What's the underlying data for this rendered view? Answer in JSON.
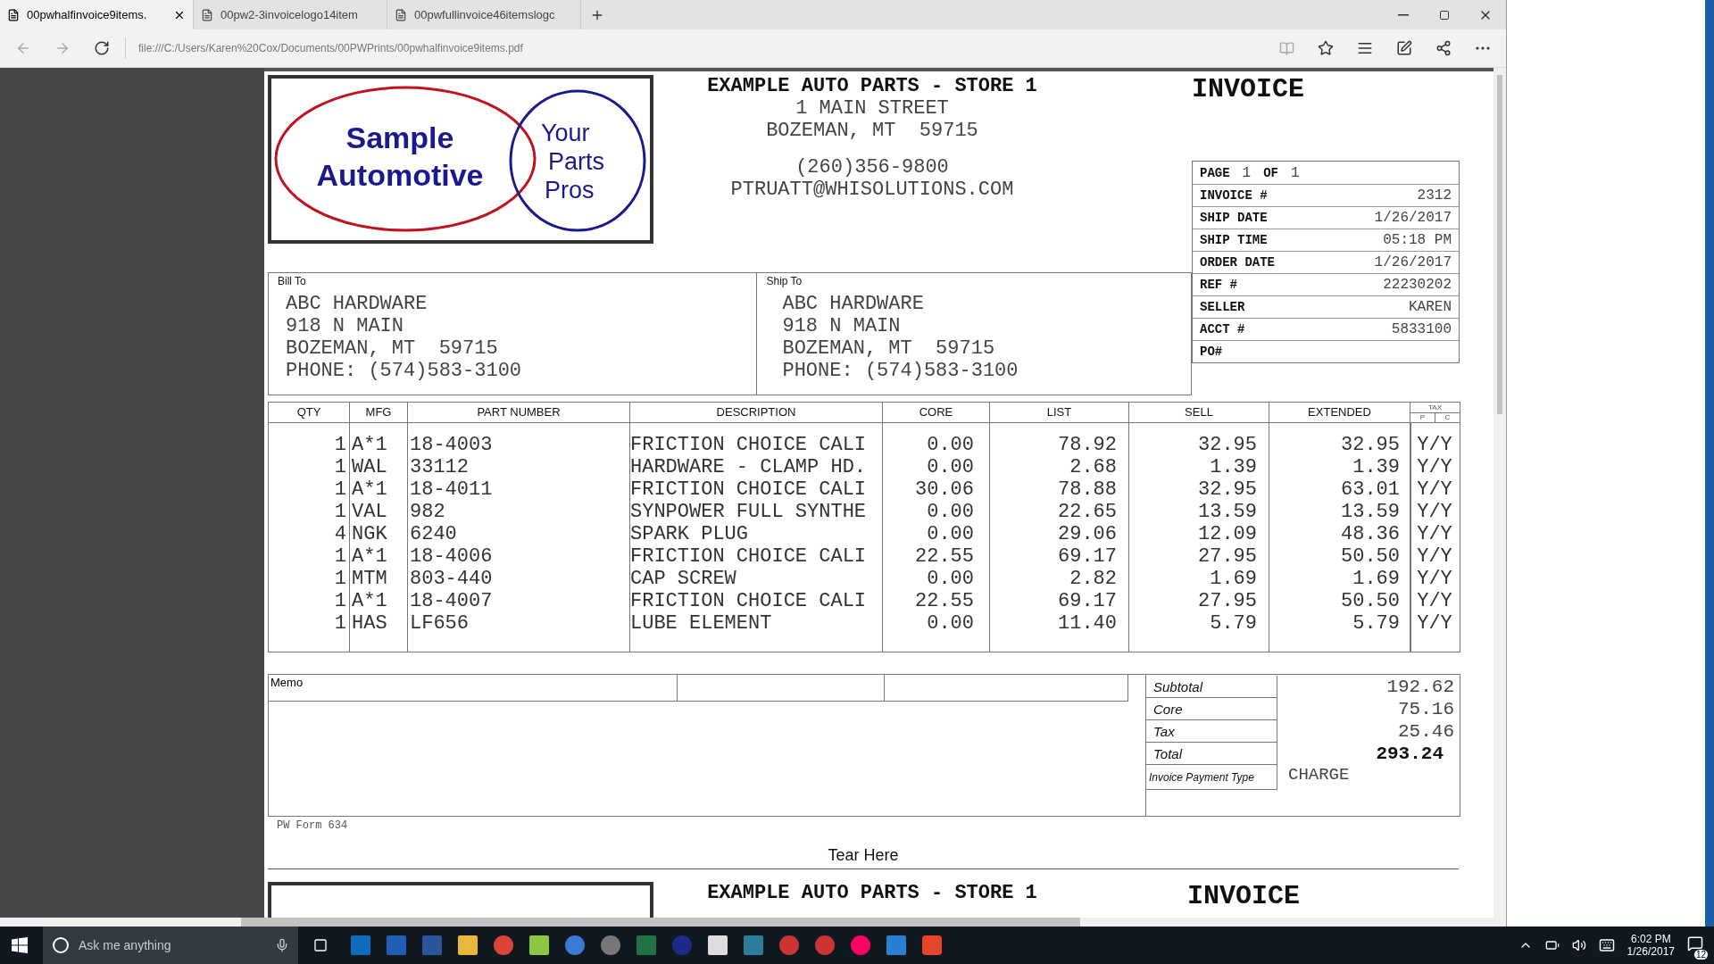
{
  "browser": {
    "tabs": [
      {
        "title": "00pwhalfinvoice9items.",
        "selected": true
      },
      {
        "title": "00pw2-3invoicelogo14item",
        "selected": false
      },
      {
        "title": "00pwfullinvoice46itemslogc",
        "selected": false
      }
    ],
    "address": "file:///C:/Users/Karen%20Cox/Documents/00PWPrints/00pwhalfinvoice9items.pdf"
  },
  "invoice": {
    "logo": {
      "name_lines": [
        "Sample",
        "Automotive"
      ],
      "tagline_lines": [
        "Your",
        "Parts",
        "Pros"
      ]
    },
    "store": {
      "name": "EXAMPLE AUTO PARTS - STORE 1",
      "address_lines": [
        "1 MAIN STREET",
        "BOZEMAN, MT  59715"
      ],
      "contact_lines": [
        "(260)356-9800",
        "PTRUATT@WHISOLUTIONS.COM"
      ]
    },
    "title": "INVOICE",
    "page": {
      "label": "PAGE",
      "current": "1",
      "of_label": "OF",
      "total": "1"
    },
    "info": [
      {
        "label": "INVOICE #",
        "value": "2312"
      },
      {
        "label": "SHIP DATE",
        "value": "1/26/2017"
      },
      {
        "label": "SHIP TIME",
        "value": "05:18 PM"
      },
      {
        "label": "ORDER DATE",
        "value": "1/26/2017"
      },
      {
        "label": "REF #",
        "value": "22230202"
      },
      {
        "label": "SELLER",
        "value": "KAREN"
      },
      {
        "label": "ACCT #",
        "value": "5833100"
      },
      {
        "label": "PO#"
      }
    ],
    "bill_to": {
      "label": "Bill To",
      "lines": [
        "ABC HARDWARE",
        "918 N MAIN",
        "BOZEMAN, MT  59715",
        "PHONE: (574)583-3100"
      ]
    },
    "ship_to": {
      "label": "Ship To",
      "lines": [
        "ABC HARDWARE",
        "918 N MAIN",
        "BOZEMAN, MT  59715",
        "PHONE: (574)583-3100"
      ]
    },
    "columns": [
      "QTY",
      "MFG",
      "PART NUMBER",
      "DESCRIPTION",
      "CORE",
      "LIST",
      "SELL",
      "EXTENDED"
    ],
    "tax_header": {
      "label": "TAX",
      "sub": [
        "P",
        "C"
      ]
    },
    "rows": [
      {
        "qty": "1",
        "mfg": "A*1",
        "part": "18-4003",
        "description": "FRICTION CHOICE CALI",
        "core": "0.00",
        "list": "78.92",
        "sell": "32.95",
        "extended": "32.95",
        "tax": "Y/Y"
      },
      {
        "qty": "1",
        "mfg": "WAL",
        "part": "33112",
        "description": "HARDWARE - CLAMP HD.",
        "core": "0.00",
        "list": "2.68",
        "sell": "1.39",
        "extended": "1.39",
        "tax": "Y/Y"
      },
      {
        "qty": "1",
        "mfg": "A*1",
        "part": "18-4011",
        "description": "FRICTION CHOICE CALI",
        "core": "30.06",
        "list": "78.88",
        "sell": "32.95",
        "extended": "63.01",
        "tax": "Y/Y"
      },
      {
        "qty": "1",
        "mfg": "VAL",
        "part": "982",
        "description": "SYNPOWER FULL SYNTHE",
        "core": "0.00",
        "list": "22.65",
        "sell": "13.59",
        "extended": "13.59",
        "tax": "Y/Y"
      },
      {
        "qty": "4",
        "mfg": "NGK",
        "part": "6240",
        "description": "SPARK PLUG",
        "core": "0.00",
        "list": "29.06",
        "sell": "12.09",
        "extended": "48.36",
        "tax": "Y/Y"
      },
      {
        "qty": "1",
        "mfg": "A*1",
        "part": "18-4006",
        "description": "FRICTION CHOICE CALI",
        "core": "22.55",
        "list": "69.17",
        "sell": "27.95",
        "extended": "50.50",
        "tax": "Y/Y"
      },
      {
        "qty": "1",
        "mfg": "MTM",
        "part": "803-440",
        "description": "CAP SCREW",
        "core": "0.00",
        "list": "2.82",
        "sell": "1.69",
        "extended": "1.69",
        "tax": "Y/Y"
      },
      {
        "qty": "1",
        "mfg": "A*1",
        "part": "18-4007",
        "description": "FRICTION CHOICE CALI",
        "core": "22.55",
        "list": "69.17",
        "sell": "27.95",
        "extended": "50.50",
        "tax": "Y/Y"
      },
      {
        "qty": "1",
        "mfg": "HAS",
        "part": "LF656",
        "description": "LUBE ELEMENT",
        "core": "0.00",
        "list": "11.40",
        "sell": "5.79",
        "extended": "5.79",
        "tax": "Y/Y"
      }
    ],
    "memo_label": "Memo",
    "totals": [
      {
        "label": "Subtotal",
        "value": "192.62",
        "kind": "plain"
      },
      {
        "label": "Core",
        "value": "75.16",
        "kind": "plain"
      },
      {
        "label": "Tax",
        "value": "25.46",
        "kind": "plain"
      },
      {
        "label": "Total",
        "value": "293.24",
        "kind": "grand"
      }
    ],
    "payment": {
      "label": "Invoice Payment Type",
      "value": "CHARGE"
    },
    "form_id": "PW Form 634",
    "tear_label": "Tear Here"
  },
  "next_invoice": {
    "store_name": "EXAMPLE AUTO PARTS - STORE 1",
    "title": "INVOICE"
  },
  "taskbar": {
    "search_placeholder": "Ask me anything",
    "time": "6:02 PM",
    "date": "1/26/2017",
    "notifications": "12"
  }
}
